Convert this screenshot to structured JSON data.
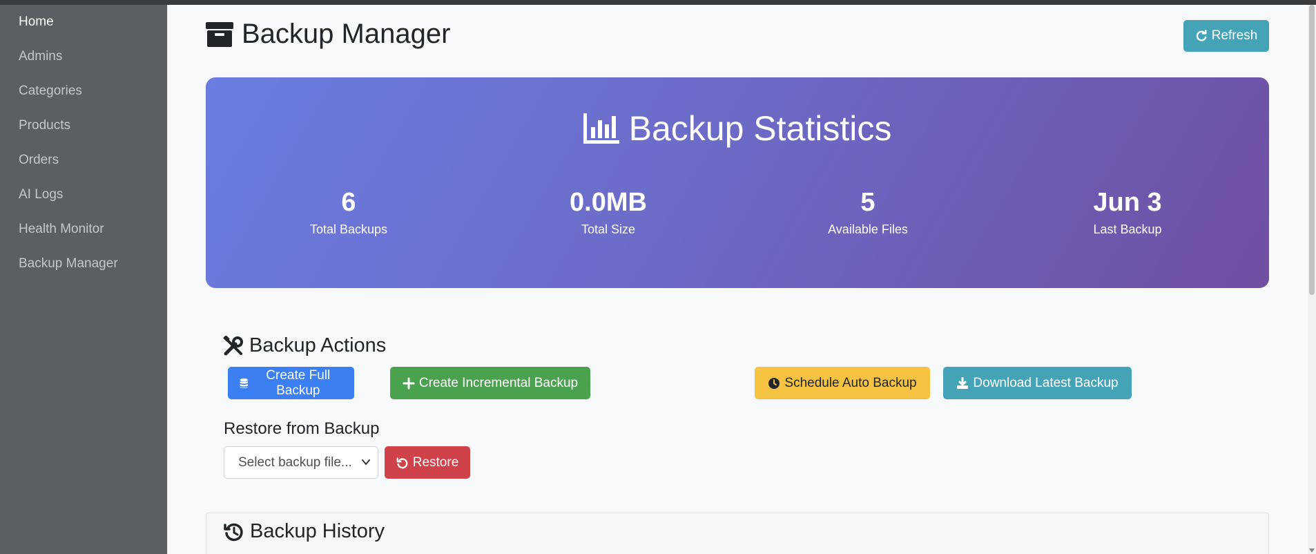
{
  "sidebar": {
    "items": [
      {
        "label": "Home",
        "active": true
      },
      {
        "label": "Admins"
      },
      {
        "label": "Categories"
      },
      {
        "label": "Products"
      },
      {
        "label": "Orders"
      },
      {
        "label": "AI Logs"
      },
      {
        "label": "Health Monitor"
      },
      {
        "label": "Backup Manager"
      }
    ]
  },
  "header": {
    "title": "Backup Manager",
    "icon": "archive-icon",
    "refresh_label": "Refresh"
  },
  "stats": {
    "title": "Backup Statistics",
    "icon": "chart-bar-icon",
    "items": [
      {
        "value": "6",
        "label": "Total Backups"
      },
      {
        "value": "0.0MB",
        "label": "Total Size"
      },
      {
        "value": "5",
        "label": "Available Files"
      },
      {
        "value": "Jun 3",
        "label": "Last Backup"
      }
    ]
  },
  "actions": {
    "title": "Backup Actions",
    "icon": "tools-icon",
    "create_full": "Create Full Backup",
    "create_incremental": "Create Incremental Backup",
    "schedule_auto": "Schedule Auto Backup",
    "download_latest": "Download Latest Backup"
  },
  "restore": {
    "label": "Restore from Backup",
    "select_placeholder": "Select backup file...",
    "button": "Restore"
  },
  "history": {
    "title": "Backup History",
    "icon": "history-icon"
  },
  "colors": {
    "primary": "#3b7ff2",
    "success": "#4aa14e",
    "warning": "#f5c242",
    "info": "#45a3b8",
    "danger": "#d0424a",
    "sidebar": "#5b5e62"
  }
}
